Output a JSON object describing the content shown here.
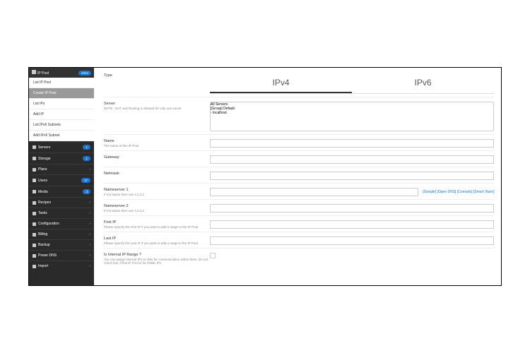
{
  "sidebar": {
    "header": {
      "label": "IP Pool",
      "badge": "2023"
    },
    "submenu": [
      {
        "label": "List IP Pool",
        "active": false
      },
      {
        "label": "Create IP Pool",
        "active": true
      },
      {
        "label": "List IPs",
        "active": false
      },
      {
        "label": "Add IP",
        "active": false
      },
      {
        "label": "List IPv6 Subnets",
        "active": false
      },
      {
        "label": "Add IPv6 Subnet",
        "active": false
      }
    ],
    "nav": [
      {
        "label": "Servers",
        "badge": "1"
      },
      {
        "label": "Storage",
        "badge": "1"
      },
      {
        "label": "Plans",
        "badge": ""
      },
      {
        "label": "Users",
        "badge": "17"
      },
      {
        "label": "Media",
        "badge": "3"
      },
      {
        "label": "Recipes",
        "badge": ""
      },
      {
        "label": "Tasks",
        "badge": ""
      },
      {
        "label": "Configuration",
        "badge": ""
      },
      {
        "label": "Billing",
        "badge": ""
      },
      {
        "label": "Backup",
        "badge": ""
      },
      {
        "label": "Power DNS",
        "badge": ""
      },
      {
        "label": "Import",
        "badge": ""
      }
    ]
  },
  "form": {
    "type_label": "Type",
    "tabs": {
      "ipv4": "IPv4",
      "ipv6": "IPv6"
    },
    "server": {
      "label": "Server",
      "help": "NOTE : NAT and Routing is allowed for only one server",
      "options": [
        "All Servers",
        "[Group] Default",
        "- localhost"
      ]
    },
    "name": {
      "label": "Name",
      "help": "The name of this IP Pool"
    },
    "gateway": {
      "label": "Gateway"
    },
    "netmask": {
      "label": "Netmask"
    },
    "ns1": {
      "label": "Nameserver 1",
      "help": "If not aware then use 4.2.2.1"
    },
    "ns2": {
      "label": "Nameserver 2",
      "help": "If not aware then use 4.2.2.2"
    },
    "firstip": {
      "label": "First IP",
      "help": "Please specify the First IP if you want to add a range to the IP Pool."
    },
    "lastip": {
      "label": "Last IP",
      "help": "Please specify the Last IP if you want to add a range to the IP Pool."
    },
    "internal": {
      "label": "Is Internal IP Range ?",
      "help": "You can assign internal IPs to VMs for communication within them. Do not check this, if this IP Pool is for Public IPs"
    },
    "dns_links": "[Google] [Open DNS] [Comodo] [Smart Viper]"
  }
}
